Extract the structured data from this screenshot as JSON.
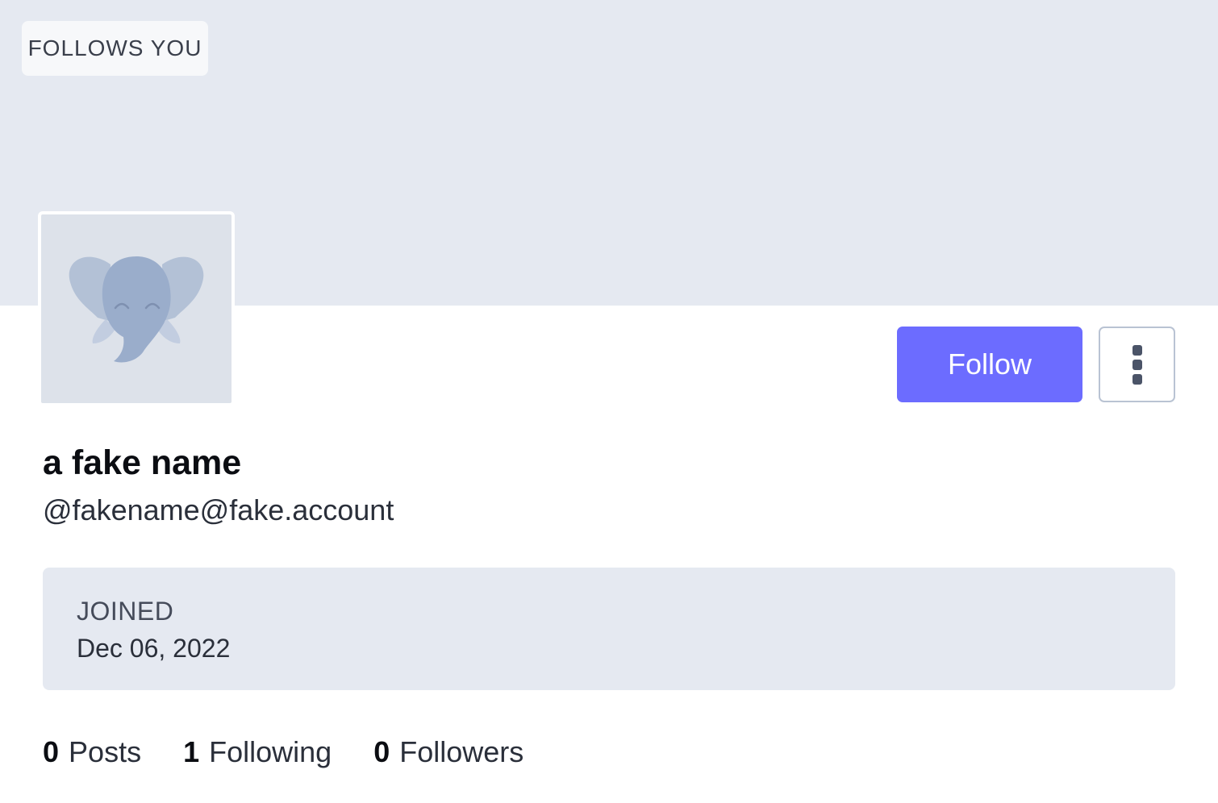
{
  "header": {
    "follows_you_badge": "FOLLOWS YOU",
    "banner_color": "#e5e9f1"
  },
  "avatar": {
    "icon": "elephant-icon"
  },
  "actions": {
    "follow_label": "Follow",
    "follow_color": "#6c6cff",
    "more_icon": "vertical-ellipsis-icon"
  },
  "profile": {
    "display_name": "a fake name",
    "handle": "@fakename@fake.account"
  },
  "joined": {
    "label": "JOINED",
    "date": "Dec 06, 2022"
  },
  "stats": [
    {
      "count": "0",
      "label": "Posts"
    },
    {
      "count": "1",
      "label": "Following"
    },
    {
      "count": "0",
      "label": "Followers"
    }
  ]
}
